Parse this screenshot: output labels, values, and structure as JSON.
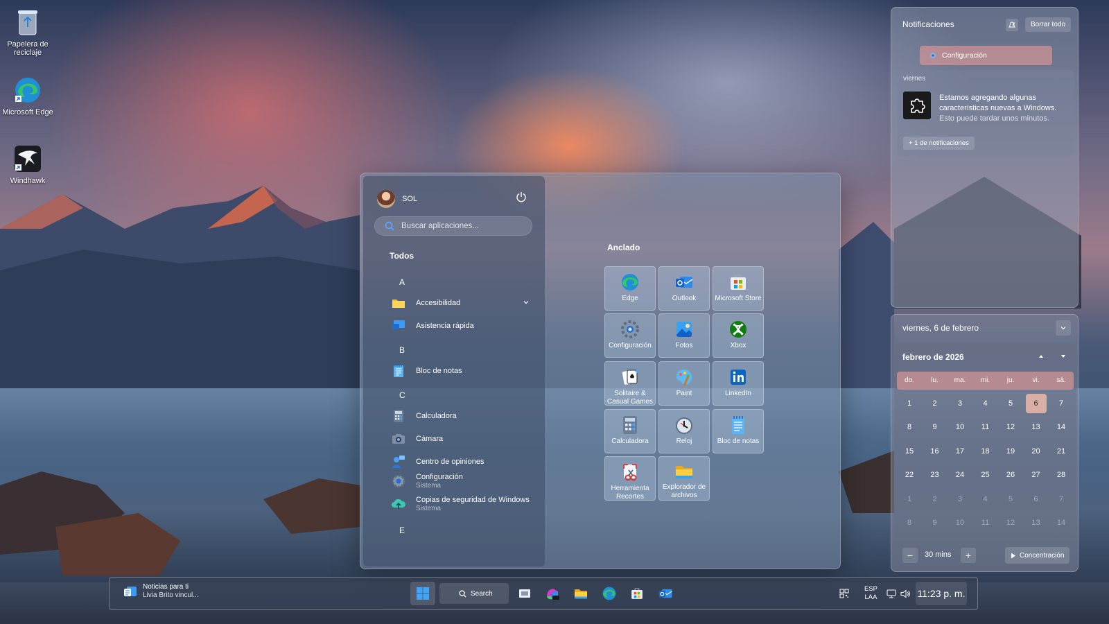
{
  "desktop": {
    "icons": [
      {
        "label": "Papelera de reciclaje"
      },
      {
        "label": "Microsoft Edge"
      },
      {
        "label": "Windhawk"
      }
    ]
  },
  "start_menu": {
    "user_name": "SOL",
    "search_placeholder": "Buscar aplicaciones...",
    "all_label": "Todos",
    "pinned_label": "Anclado",
    "app_list": [
      {
        "letter": "A"
      },
      {
        "name": "Accesibilidad",
        "icon": "folder-icon"
      },
      {
        "name": "Asistencia rápida",
        "icon": "quick-assist-icon"
      },
      {
        "letter": "B"
      },
      {
        "name": "Bloc de notas",
        "icon": "notepad-icon"
      },
      {
        "letter": "C"
      },
      {
        "name": "Calculadora",
        "icon": "calculator-icon"
      },
      {
        "name": "Cámara",
        "icon": "camera-icon"
      },
      {
        "name": "Centro de opiniones",
        "icon": "feedback-hub-icon"
      },
      {
        "name": "Configuración",
        "sub": "Sistema",
        "icon": "settings-icon"
      },
      {
        "name": "Copias de seguridad de Windows",
        "sub": "Sistema",
        "icon": "backup-icon"
      },
      {
        "letter": "E"
      }
    ],
    "pinned": [
      {
        "label": "Edge",
        "icon": "edge-icon"
      },
      {
        "label": "Outlook",
        "icon": "outlook-icon"
      },
      {
        "label": "Microsoft Store",
        "icon": "store-icon"
      },
      {
        "label": "Configuración",
        "icon": "settings-icon"
      },
      {
        "label": "Fotos",
        "icon": "photos-icon"
      },
      {
        "label": "Xbox",
        "icon": "xbox-icon"
      },
      {
        "label": "Solitaire & Casual Games",
        "icon": "solitaire-icon"
      },
      {
        "label": "Paint",
        "icon": "paint-icon"
      },
      {
        "label": "LinkedIn",
        "icon": "linkedin-icon"
      },
      {
        "label": "Calculadora",
        "icon": "calculator-icon"
      },
      {
        "label": "Reloj",
        "icon": "clock-icon"
      },
      {
        "label": "Bloc de notas",
        "icon": "notepad-icon"
      },
      {
        "label": "Herramienta Recortes",
        "icon": "snipping-tool-icon"
      },
      {
        "label": "Explorador de archivos",
        "icon": "file-explorer-icon"
      }
    ]
  },
  "notifications": {
    "title": "Notificaciones",
    "clear_all": "Borrar todo",
    "config_chip": "Configuración",
    "day": "viernes",
    "message_line1": "Estamos agregando algunas características nuevas a Windows.",
    "message_line2": "Esto puede tardar unos minutos.",
    "more": "+ 1 de notificaciones"
  },
  "calendar": {
    "date_header": "viernes, 6 de febrero",
    "month_label": "febrero de 2026",
    "days_of_week": [
      "do.",
      "lu.",
      "ma.",
      "mi.",
      "ju.",
      "vi.",
      "sá."
    ],
    "weeks": [
      [
        "1",
        "2",
        "3",
        "4",
        "5",
        "6",
        "7"
      ],
      [
        "8",
        "9",
        "10",
        "11",
        "12",
        "13",
        "14"
      ],
      [
        "15",
        "16",
        "17",
        "18",
        "19",
        "20",
        "21"
      ],
      [
        "22",
        "23",
        "24",
        "25",
        "26",
        "27",
        "28"
      ],
      [
        "1",
        "2",
        "3",
        "4",
        "5",
        "6",
        "7"
      ],
      [
        "8",
        "9",
        "10",
        "11",
        "12",
        "13",
        "14"
      ]
    ],
    "today": "6",
    "focus_minutes": "30 mins",
    "focus_label": "Concentración"
  },
  "taskbar": {
    "news_title": "Noticias para ti",
    "news_sub": "Livia Brito vincul...",
    "search_label": "Search",
    "lang_line1": "ESP",
    "lang_line2": "LAA",
    "time": "11:23 p. m."
  }
}
